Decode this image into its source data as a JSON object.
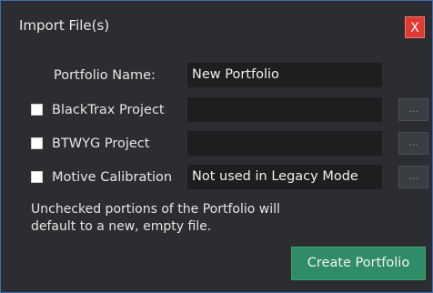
{
  "window": {
    "title": "Import File(s)",
    "close_label": "X"
  },
  "form": {
    "portfolio_name_label": "Portfolio Name:",
    "portfolio_name_value": "New Portfolio",
    "rows": [
      {
        "label": "BlackTrax Project",
        "checked": false,
        "value": "",
        "browse_label": "..."
      },
      {
        "label": "BTWYG Project",
        "checked": false,
        "value": "",
        "browse_label": "..."
      },
      {
        "label": "Motive Calibration",
        "checked": false,
        "value": "Not used in Legacy Mode",
        "browse_label": "..."
      }
    ]
  },
  "info_text": "Unchecked portions of the Portfolio will default to a new, empty file.",
  "actions": {
    "create_label": "Create Portfolio"
  },
  "colors": {
    "accent_border": "#3d6db3",
    "close_red": "#e03a33",
    "create_green": "#2f8c66",
    "background": "#2b2d30",
    "field_bg": "#1c1e20"
  }
}
